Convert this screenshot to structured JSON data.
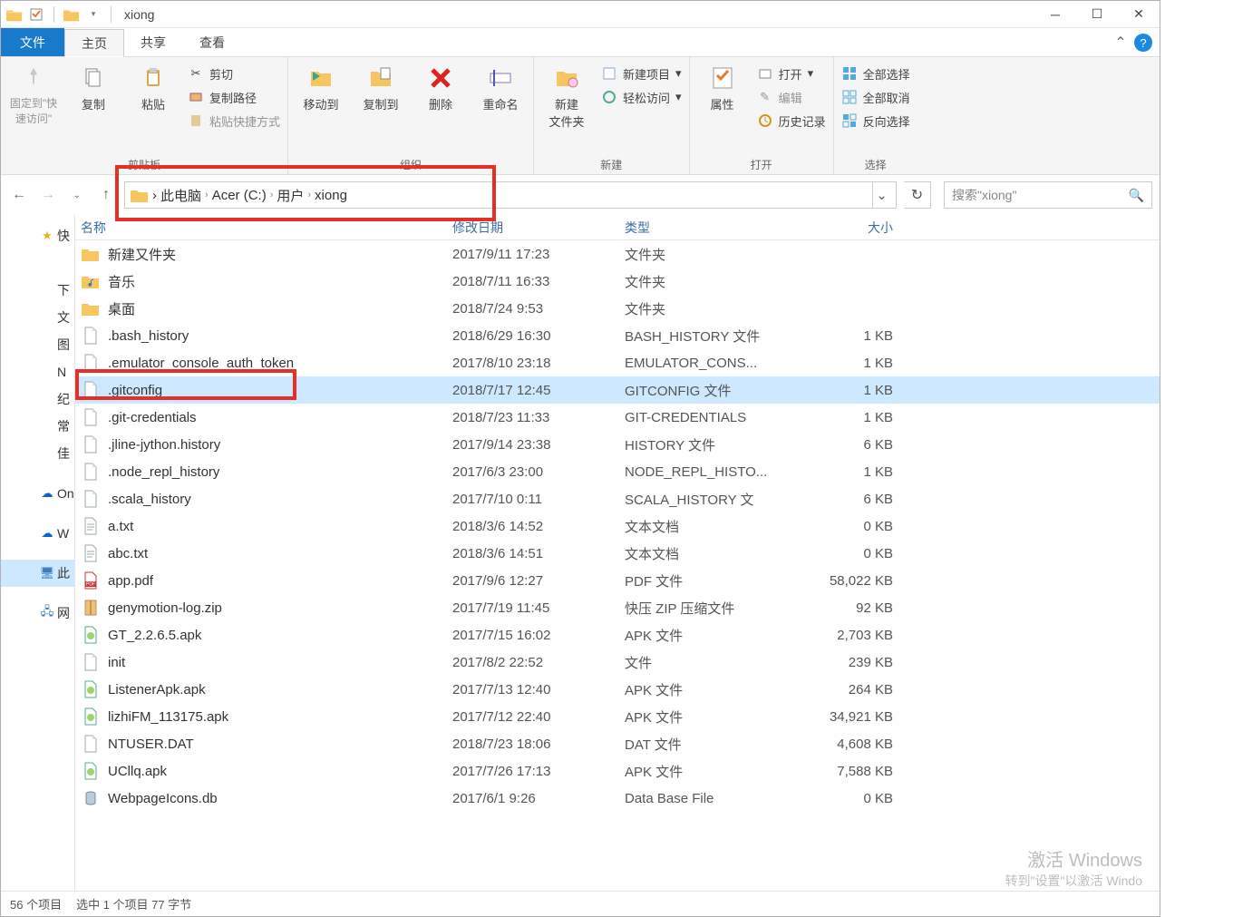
{
  "window": {
    "title": "xiong",
    "min_tip": "Minimize",
    "max_tip": "Maximize",
    "close_tip": "Close"
  },
  "tabs": {
    "file": "文件",
    "home": "主页",
    "share": "共享",
    "view": "查看"
  },
  "ribbon": {
    "clipboard": {
      "pin": "固定到\"快\n速访问\"",
      "copy": "复制",
      "paste": "粘贴",
      "cut": "剪切",
      "copy_path": "复制路径",
      "paste_shortcut": "粘贴快捷方式",
      "group": "剪贴板"
    },
    "organize": {
      "move_to": "移动到",
      "copy_to": "复制到",
      "delete": "删除",
      "rename": "重命名",
      "group": "组织"
    },
    "new": {
      "new_folder": "新建\n文件夹",
      "new_item": "新建项目",
      "easy_access": "轻松访问",
      "group": "新建"
    },
    "open": {
      "properties": "属性",
      "open": "打开",
      "edit": "编辑",
      "history": "历史记录",
      "group": "打开"
    },
    "select": {
      "select_all": "全部选择",
      "select_none": "全部取消",
      "invert": "反向选择",
      "group": "选择"
    }
  },
  "breadcrumb": [
    "此电脑",
    "Acer (C:)",
    "用户",
    "xiong"
  ],
  "search_placeholder": "搜索\"xiong\"",
  "sidebar": {
    "quick": "快",
    "items": [
      "​",
      "下",
      "文",
      "图",
      "N",
      "纪",
      "常",
      "佳"
    ],
    "onedrive_on": "On",
    "onedrive_w": "W",
    "this_pc": "此",
    "network": "网"
  },
  "headers": {
    "name": "名称",
    "date": "修改日期",
    "type": "类型",
    "size": "大小"
  },
  "files": [
    {
      "icon": "folder",
      "name": "新建又件夹",
      "date": "2017/9/11 17:23",
      "type": "文件夹",
      "size": ""
    },
    {
      "icon": "music-folder",
      "name": "音乐",
      "date": "2018/7/11 16:33",
      "type": "文件夹",
      "size": ""
    },
    {
      "icon": "folder",
      "name": "桌面",
      "date": "2018/7/24 9:53",
      "type": "文件夹",
      "size": ""
    },
    {
      "icon": "file",
      "name": ".bash_history",
      "date": "2018/6/29 16:30",
      "type": "BASH_HISTORY 文件",
      "size": "1 KB"
    },
    {
      "icon": "file",
      "name": ".emulator_console_auth_token",
      "date": "2017/8/10 23:18",
      "type": "EMULATOR_CONS...",
      "size": "1 KB"
    },
    {
      "icon": "file",
      "name": ".gitconfig",
      "date": "2018/7/17 12:45",
      "type": "GITCONFIG 文件",
      "size": "1 KB",
      "selected": true
    },
    {
      "icon": "file",
      "name": ".git-credentials",
      "date": "2018/7/23 11:33",
      "type": "GIT-CREDENTIALS",
      "size": "1 KB"
    },
    {
      "icon": "file",
      "name": ".jline-jython.history",
      "date": "2017/9/14 23:38",
      "type": "HISTORY 文件",
      "size": "6 KB"
    },
    {
      "icon": "file",
      "name": ".node_repl_history",
      "date": "2017/6/3 23:00",
      "type": "NODE_REPL_HISTO...",
      "size": "1 KB"
    },
    {
      "icon": "file",
      "name": ".scala_history",
      "date": "2017/7/10 0:11",
      "type": "SCALA_HISTORY 文",
      "size": "6 KB"
    },
    {
      "icon": "text",
      "name": "a.txt",
      "date": "2018/3/6 14:52",
      "type": "文本文档",
      "size": "0 KB"
    },
    {
      "icon": "text",
      "name": "abc.txt",
      "date": "2018/3/6 14:51",
      "type": "文本文档",
      "size": "0 KB"
    },
    {
      "icon": "pdf",
      "name": "app.pdf",
      "date": "2017/9/6 12:27",
      "type": "PDF 文件",
      "size": "58,022 KB"
    },
    {
      "icon": "zip",
      "name": "genymotion-log.zip",
      "date": "2017/7/19 11:45",
      "type": "快压 ZIP 压缩文件",
      "size": "92 KB"
    },
    {
      "icon": "apk",
      "name": "GT_2.2.6.5.apk",
      "date": "2017/7/15 16:02",
      "type": "APK 文件",
      "size": "2,703 KB"
    },
    {
      "icon": "file",
      "name": "init",
      "date": "2017/8/2 22:52",
      "type": "文件",
      "size": "239 KB"
    },
    {
      "icon": "apk",
      "name": "ListenerApk.apk",
      "date": "2017/7/13 12:40",
      "type": "APK 文件",
      "size": "264 KB"
    },
    {
      "icon": "apk",
      "name": "lizhiFM_113175.apk",
      "date": "2017/7/12 22:40",
      "type": "APK 文件",
      "size": "34,921 KB"
    },
    {
      "icon": "file",
      "name": "NTUSER.DAT",
      "date": "2018/7/23 18:06",
      "type": "DAT 文件",
      "size": "4,608 KB"
    },
    {
      "icon": "apk",
      "name": "UCllq.apk",
      "date": "2017/7/26 17:13",
      "type": "APK 文件",
      "size": "7,588 KB"
    },
    {
      "icon": "db",
      "name": "WebpageIcons.db",
      "date": "2017/6/1 9:26",
      "type": "Data Base File",
      "size": "0 KB"
    }
  ],
  "status": {
    "count": "56 个项目",
    "selection": "选中 1 个项目 77 字节"
  },
  "watermark": {
    "title": "激活 Windows",
    "sub": "转到\"设置\"以激活 Windo"
  }
}
